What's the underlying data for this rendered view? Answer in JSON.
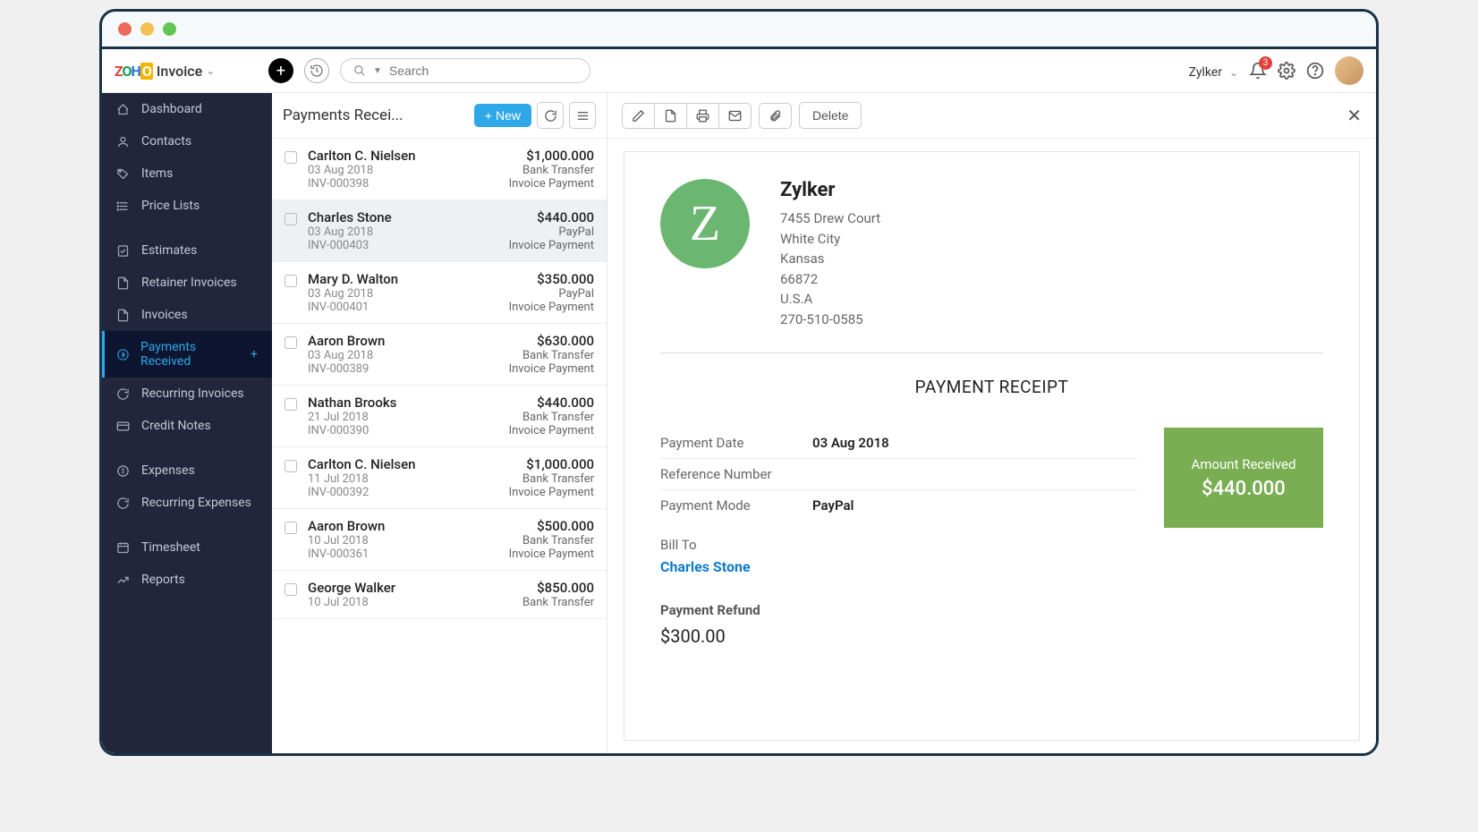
{
  "brand": {
    "z": "Z",
    "o1": "O",
    "h": "H",
    "o2": "O",
    "product": "Invoice"
  },
  "search": {
    "placeholder": "Search"
  },
  "header": {
    "org": "Zylker",
    "notification_count": 3
  },
  "sidebar": [
    {
      "label": "Dashboard",
      "icon": "dashboard-icon"
    },
    {
      "label": "Contacts",
      "icon": "person-icon"
    },
    {
      "label": "Items",
      "icon": "tag-icon"
    },
    {
      "label": "Price Lists",
      "icon": "list-icon"
    },
    {
      "label": "Estimates",
      "icon": "estimate-icon",
      "gap": true
    },
    {
      "label": "Retainer Invoices",
      "icon": "doc-icon"
    },
    {
      "label": "Invoices",
      "icon": "doc-icon"
    },
    {
      "label": "Payments Received",
      "icon": "payment-icon",
      "active": true,
      "plus": true
    },
    {
      "label": "Recurring Invoices",
      "icon": "recurring-icon"
    },
    {
      "label": "Credit Notes",
      "icon": "credit-icon"
    },
    {
      "label": "Expenses",
      "icon": "expense-icon",
      "gap": true
    },
    {
      "label": "Recurring Expenses",
      "icon": "recurring-icon"
    },
    {
      "label": "Timesheet",
      "icon": "time-icon",
      "gap": true
    },
    {
      "label": "Reports",
      "icon": "chart-icon"
    }
  ],
  "list": {
    "title": "Payments Recei...",
    "new_label": "New",
    "items": [
      {
        "name": "Carlton C. Nielsen",
        "amount": "$1,000.000",
        "date": "03 Aug 2018",
        "method": "Bank Transfer",
        "inv": "INV-000398",
        "type": "Invoice Payment"
      },
      {
        "name": "Charles Stone",
        "amount": "$440.000",
        "date": "03 Aug 2018",
        "method": "PayPal",
        "inv": "INV-000403",
        "type": "Invoice Payment",
        "selected": true
      },
      {
        "name": "Mary D. Walton",
        "amount": "$350.000",
        "date": "03 Aug 2018",
        "method": "PayPal",
        "inv": "INV-000401",
        "type": "Invoice Payment"
      },
      {
        "name": "Aaron Brown",
        "amount": "$630.000",
        "date": "03 Aug 2018",
        "method": "Bank Transfer",
        "inv": "INV-000389",
        "type": "Invoice Payment"
      },
      {
        "name": "Nathan Brooks",
        "amount": "$440.000",
        "date": "21 Jul 2018",
        "method": "Bank Transfer",
        "inv": "INV-000390",
        "type": "Invoice Payment"
      },
      {
        "name": "Carlton C. Nielsen",
        "amount": "$1,000.000",
        "date": "11 Jul 2018",
        "method": "Bank Transfer",
        "inv": "INV-000392",
        "type": "Invoice Payment"
      },
      {
        "name": "Aaron Brown",
        "amount": "$500.000",
        "date": "10 Jul 2018",
        "method": "Bank Transfer",
        "inv": "INV-000361",
        "type": "Invoice Payment"
      },
      {
        "name": "George Walker",
        "amount": "$850.000",
        "date": "10 Jul 2018",
        "method": "Bank Transfer",
        "inv": "",
        "type": ""
      }
    ]
  },
  "toolbar": {
    "delete_label": "Delete"
  },
  "receipt": {
    "company": "Zylker",
    "logo_letter": "Z",
    "address": [
      "7455 Drew Court",
      "White City",
      "Kansas",
      "66872",
      "U.S.A",
      "270-510-0585"
    ],
    "title": "PAYMENT RECEIPT",
    "payment_date_label": "Payment Date",
    "payment_date": "03 Aug 2018",
    "reference_label": "Reference Number",
    "reference": "",
    "mode_label": "Payment Mode",
    "mode": "PayPal",
    "billto_label": "Bill To",
    "billto_name": "Charles Stone",
    "box_label": "Amount Received",
    "box_amount": "$440.000",
    "refund_label": "Payment Refund",
    "refund_amount": "$300.00"
  }
}
